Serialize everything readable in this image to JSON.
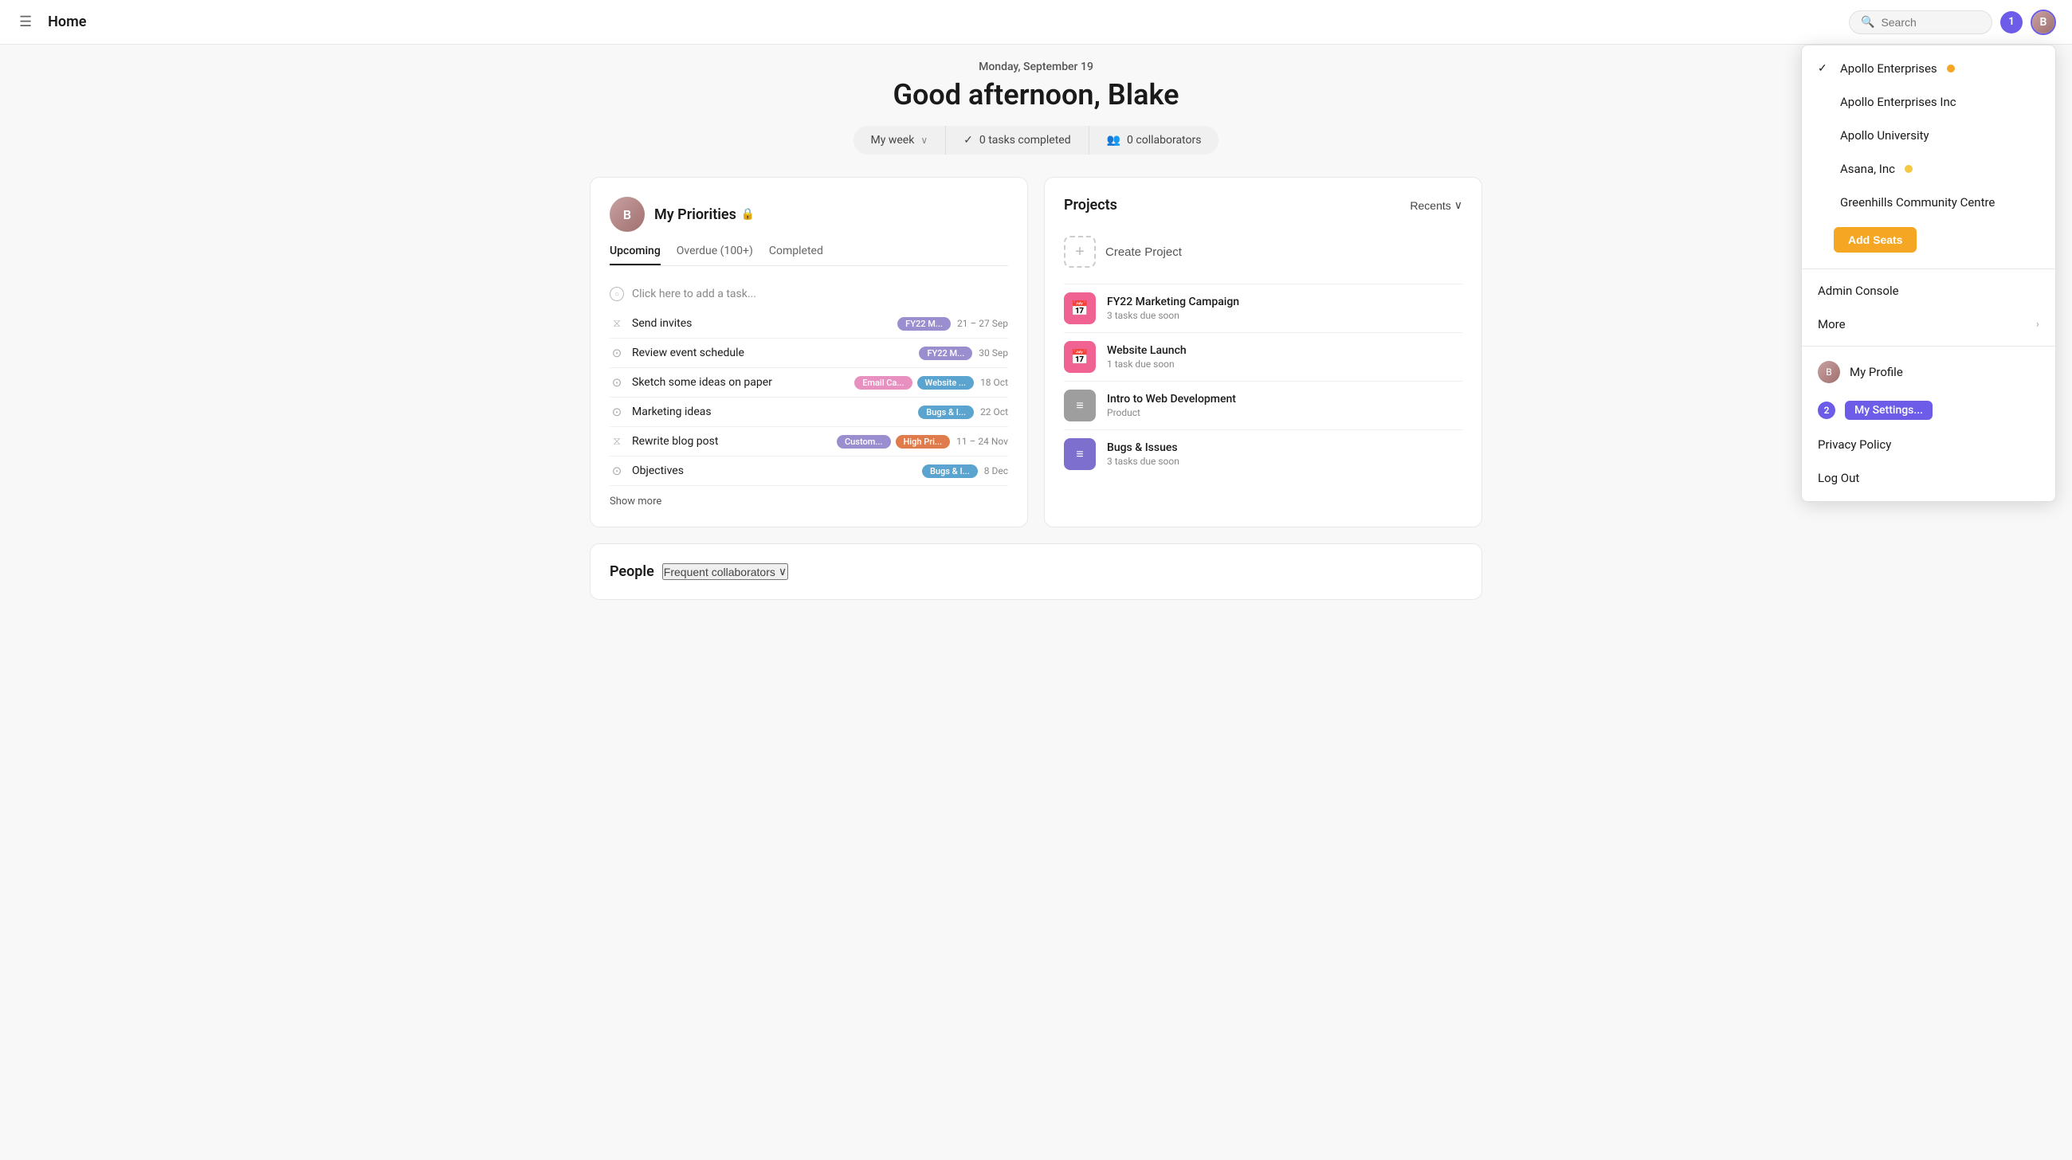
{
  "nav": {
    "title": "Home",
    "search_placeholder": "Search",
    "notification_count": "1"
  },
  "greeting": {
    "date": "Monday, September 19",
    "text": "Good afternoon, Blake",
    "my_week_label": "My week",
    "tasks_completed": "0 tasks completed",
    "collaborators": "0 collaborators"
  },
  "my_priorities": {
    "title": "My Priorities",
    "tabs": [
      "Upcoming",
      "Overdue (100+)",
      "Completed"
    ],
    "active_tab": "Upcoming",
    "add_task_placeholder": "Click here to add a task...",
    "tasks": [
      {
        "name": "Send invites",
        "icon": "hourglass",
        "tags": [
          {
            "label": "FY22 M...",
            "color": "purple"
          }
        ],
        "date": "21 – 27 Sep"
      },
      {
        "name": "Review event schedule",
        "icon": "check",
        "tags": [
          {
            "label": "FY22 M...",
            "color": "purple"
          }
        ],
        "date": "30 Sep"
      },
      {
        "name": "Sketch some ideas on paper",
        "icon": "check",
        "tags": [
          {
            "label": "Email Ca...",
            "color": "pink"
          },
          {
            "label": "Website ...",
            "color": "blue"
          }
        ],
        "date": "18 Oct"
      },
      {
        "name": "Marketing ideas",
        "icon": "check",
        "tags": [
          {
            "label": "Bugs & I...",
            "color": "blue"
          }
        ],
        "date": "22 Oct"
      },
      {
        "name": "Rewrite blog post",
        "icon": "hourglass",
        "tags": [
          {
            "label": "Custom...",
            "color": "purple"
          },
          {
            "label": "High Pri...",
            "color": "orange"
          }
        ],
        "date": "11 – 24 Nov"
      },
      {
        "name": "Objectives",
        "icon": "check",
        "tags": [
          {
            "label": "Bugs & I...",
            "color": "blue"
          }
        ],
        "date": "8 Dec"
      }
    ],
    "show_more_label": "Show more"
  },
  "projects": {
    "title": "Projects",
    "recents_label": "Recents",
    "create_label": "Create Project",
    "items": [
      {
        "name": "FY22 Marketing Campaign",
        "sub": "3 tasks due soon",
        "icon": "calendar",
        "color": "pink"
      },
      {
        "name": "Website Launch",
        "sub": "1 task due soon",
        "icon": "calendar",
        "color": "pink"
      },
      {
        "name": "Intro to Web Development",
        "sub": "Product",
        "icon": "list",
        "color": "gray"
      },
      {
        "name": "Bugs & Issues",
        "sub": "3 tasks due soon",
        "icon": "list",
        "color": "purple"
      }
    ]
  },
  "people": {
    "title": "People",
    "freq_label": "Frequent collaborators"
  },
  "dropdown": {
    "orgs": [
      {
        "name": "Apollo Enterprises",
        "checked": true,
        "dot": "orange"
      },
      {
        "name": "Apollo Enterprises Inc",
        "checked": false,
        "dot": null
      },
      {
        "name": "Apollo University",
        "checked": false,
        "dot": null
      },
      {
        "name": "Asana, Inc",
        "checked": false,
        "dot": "yellow"
      },
      {
        "name": "Greenhills Community Centre",
        "checked": false,
        "dot": null
      }
    ],
    "add_seats_label": "Add Seats",
    "admin_console_label": "Admin Console",
    "more_label": "More",
    "my_profile_label": "My Profile",
    "my_settings_label": "My Settings...",
    "notification_num": "2",
    "privacy_policy_label": "Privacy Policy",
    "log_out_label": "Log Out"
  }
}
